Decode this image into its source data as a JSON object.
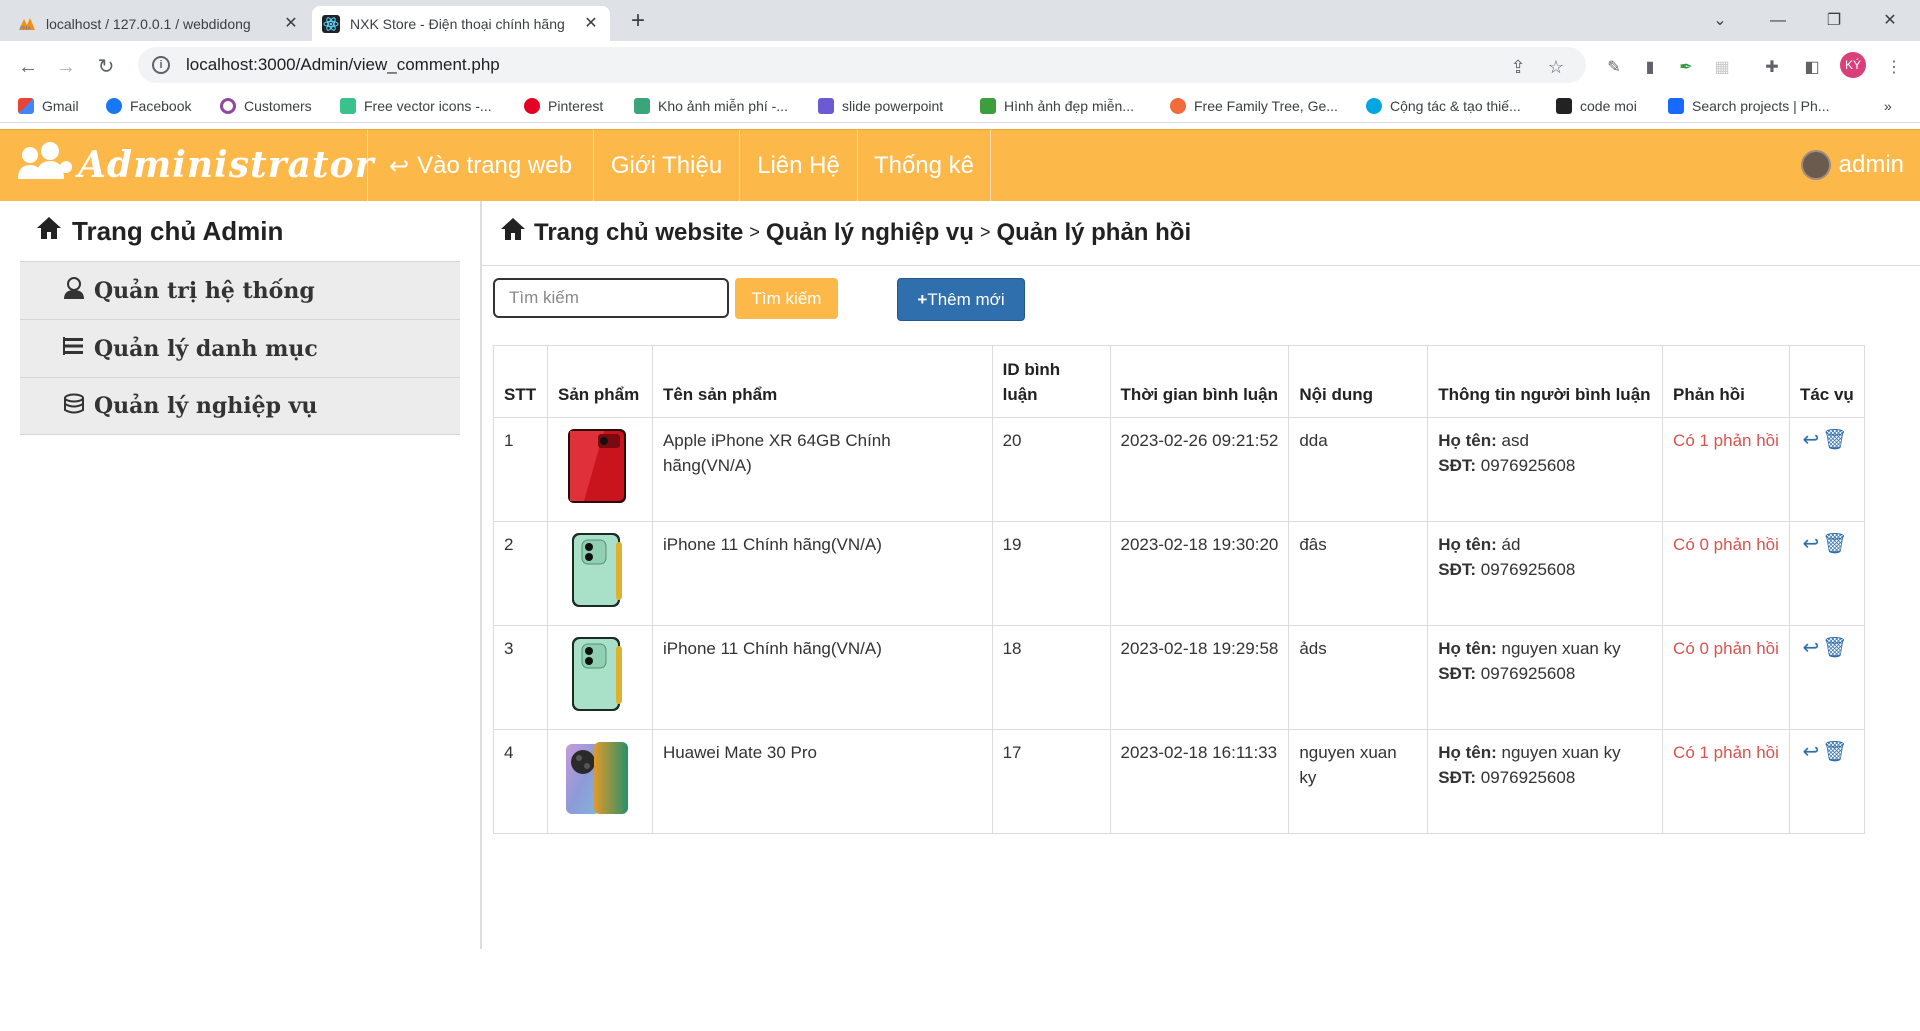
{
  "browser": {
    "tabs": [
      {
        "title": "localhost / 127.0.0.1 / webdidong",
        "active": false
      },
      {
        "title": "NXK Store - Điện thoại chính hãng",
        "active": true
      }
    ],
    "url": "localhost:3000/Admin/view_comment.php",
    "profile_initials": "KÝ",
    "bookmarks": [
      "Gmail",
      "Facebook",
      "Customers",
      "Free vector icons -...",
      "Pinterest",
      "Kho ảnh miễn phí -...",
      "slide powerpoint",
      "Hình ảnh đẹp miễn...",
      "Free Family Tree, Ge...",
      "Cộng tác & tạo thiế...",
      "code moi",
      "Search projects | Ph..."
    ]
  },
  "header": {
    "brand": "Administrator",
    "nav": [
      "Vào trang web",
      "Giới Thiệu",
      "Liên Hệ",
      "Thống kê"
    ],
    "user": "admin"
  },
  "sidebar": {
    "home": "Trang chủ Admin",
    "items": [
      "Quản trị hệ thống",
      "Quản lý danh mục",
      "Quản lý nghiệp vụ"
    ]
  },
  "breadcrumb": [
    "Trang chủ website",
    "Quản lý nghiệp vụ",
    "Quản lý phản hồi"
  ],
  "search": {
    "placeholder": "Tìm kiếm",
    "button": "Tìm kiếm"
  },
  "add_button": "Thêm mới",
  "table": {
    "headers": [
      "STT",
      "Sản phẩm",
      "Tên sản phẩm",
      "ID bình luận",
      "Thời gian bình luận",
      "Nội dung",
      "Thông tin người bình luận",
      "Phản hồi",
      "Tác vụ"
    ],
    "name_label": "Họ tên:",
    "phone_label": "SĐT:",
    "rows": [
      {
        "stt": "1",
        "product": "Apple iPhone XR 64GB Chính hãng(VN/A)",
        "image": "iphone-xr-red",
        "id": "20",
        "time": "2023-02-26 09:21:52",
        "content": "dda",
        "name": "asd",
        "phone": "0976925608",
        "reply": "Có 1 phản hồi"
      },
      {
        "stt": "2",
        "product": "iPhone 11 Chính hãng(VN/A)",
        "image": "iphone-11-green",
        "id": "19",
        "time": "2023-02-18 19:30:20",
        "content": "đâs",
        "name": "ád",
        "phone": "0976925608",
        "reply": "Có 0 phản hồi"
      },
      {
        "stt": "3",
        "product": "iPhone 11 Chính hãng(VN/A)",
        "image": "iphone-11-green",
        "id": "18",
        "time": "2023-02-18 19:29:58",
        "content": "ảds",
        "name": "nguyen xuan ky",
        "phone": "0976925608",
        "reply": "Có 0 phản hồi"
      },
      {
        "stt": "4",
        "product": "Huawei Mate 30 Pro",
        "image": "huawei-mate-30-pro",
        "id": "17",
        "time": "2023-02-18 16:11:33",
        "content": "nguyen xuan ky",
        "name": "nguyen xuan ky",
        "phone": "0976925608",
        "reply": "Có 1 phản hồi"
      }
    ]
  },
  "colors": {
    "accent": "#fdb84a",
    "primary": "#2f6fad",
    "reply": "#d9534f"
  }
}
